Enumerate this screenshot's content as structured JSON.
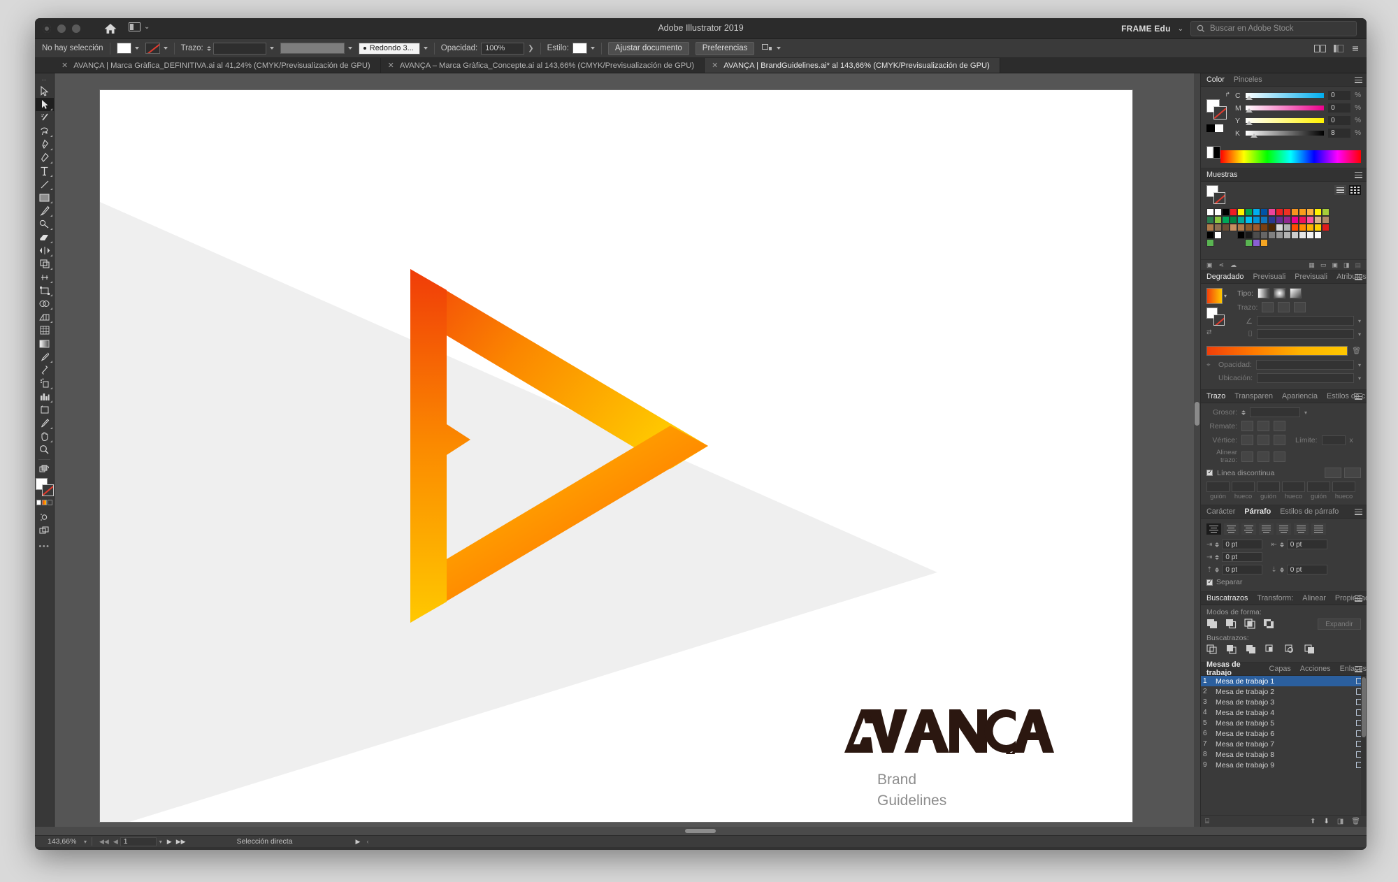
{
  "app": {
    "title": "Adobe Illustrator 2019",
    "workspace": "FRAME Edu",
    "stock_placeholder": "Buscar en Adobe Stock"
  },
  "controlbar": {
    "selection_status": "No hay selección",
    "stroke_label": "Trazo:",
    "brush_value": "Redondo 3...",
    "opacity_label": "Opacidad:",
    "opacity_value": "100%",
    "style_label": "Estilo:",
    "fit_document_button": "Ajustar documento",
    "preferences_button": "Preferencias"
  },
  "document_tabs": [
    {
      "label": "AVANÇA | Marca Gràfica_DEFINITIVA.ai al 41,24% (CMYK/Previsualización de GPU)",
      "active": false
    },
    {
      "label": "AVANÇA – Marca Gràfica_Concepte.ai al 143,66% (CMYK/Previsualización de GPU)",
      "active": false
    },
    {
      "label": "AVANÇA | BrandGuidelines.ai* al 143,66% (CMYK/Previsualización de GPU)",
      "active": true
    }
  ],
  "toolbar": {
    "tools": [
      "selection-tool",
      "direct-selection-tool",
      "magic-wand-tool",
      "lasso-tool",
      "pen-tool",
      "curvature-tool",
      "type-tool",
      "line-segment-tool",
      "rectangle-tool",
      "paintbrush-tool",
      "shaper-tool",
      "eraser-tool",
      "rotate-tool",
      "scale-tool",
      "width-tool",
      "free-transform-tool",
      "shape-builder-tool",
      "perspective-grid-tool",
      "mesh-tool",
      "gradient-tool",
      "eyedropper-tool",
      "blend-tool",
      "symbol-sprayer-tool",
      "column-graph-tool",
      "artboard-tool",
      "slice-tool",
      "hand-tool",
      "zoom-tool"
    ],
    "selected_tool": "direct-selection-tool"
  },
  "canvas": {
    "brand_name": "AVANÇA",
    "brand_subtitle_line1": "Brand",
    "brand_subtitle_line2": "Guidelines",
    "gradient_start": "#F2400A",
    "gradient_end": "#FFC800",
    "wedge_color": "#EFEFEF",
    "wordmark_color": "#2B1710",
    "subtitle_color": "#8D8D8D"
  },
  "panels": {
    "color": {
      "tabs": [
        "Color",
        "Pinceles"
      ],
      "active_tab": "Color",
      "channels": [
        {
          "label": "C",
          "value": "0",
          "unit": "%"
        },
        {
          "label": "M",
          "value": "0",
          "unit": "%"
        },
        {
          "label": "Y",
          "value": "0",
          "unit": "%"
        },
        {
          "label": "K",
          "value": "8",
          "unit": "%"
        }
      ]
    },
    "swatches": {
      "tabs": [
        "Muestras"
      ],
      "active_tab": "Muestras",
      "rows": [
        [
          "#ffffff",
          "#000000",
          "#ed1c24",
          "#fff200",
          "#00a650",
          "#00aeef",
          "#0054a6",
          "#ec449c",
          "#ed2024",
          "#ee3124",
          "#f7941e",
          "#f99d1c",
          "#fbb040",
          "#fff200",
          "#a6ce39",
          "#8dc63f"
        ],
        [
          "#00a859",
          "#008542",
          "#00a99d",
          "#00bff3",
          "#0095da",
          "#0f75bc",
          "#2b3990",
          "#662d91",
          "#92278f",
          "#ec008c",
          "#ed145b",
          "#f852a0",
          "#d9b38c",
          "#b08968",
          "#8c6f52",
          "#6b4f35"
        ],
        [
          "#c89060",
          "#b07b4a",
          "#8a5a2b",
          "#a05a2c",
          "#7b3f10",
          "#4d2600",
          "#d9d9d9",
          "#b3b3b3",
          "#ff4d00",
          "#ff8c00",
          "#ffb400",
          "#ffd000",
          "#e01b1b",
          "#ffffff"
        ],
        [
          "#000000",
          "#1a1a1a",
          "#4d4d4d",
          "#666666",
          "#808080",
          "#999999",
          "#b3b3b3",
          "#cccccc",
          "#e6e6e6",
          "#f2f2f2",
          "#fafafa"
        ],
        [
          "#5ab552",
          "#8a5fd4",
          "#f5a623"
        ]
      ]
    },
    "gradient": {
      "tabs": [
        "Degradado",
        "Previsuali",
        "Previsuali",
        "Atributos"
      ],
      "active_tab": "Degradado",
      "type_label": "Tipo:",
      "stroke_label": "Trazo:",
      "opacity_label": "Opacidad:",
      "location_label": "Ubicación:"
    },
    "stroke": {
      "tabs": [
        "Trazo",
        "Transparen",
        "Apariencia",
        "Estilos de c"
      ],
      "active_tab": "Trazo",
      "weight_label": "Grosor:",
      "cap_label": "Remate:",
      "corner_label": "Vértice:",
      "limit_label": "Límite:",
      "limit_unit": "x",
      "align_label": "Alinear trazo:",
      "dashed_label": "Línea discontinua",
      "dash_fields": [
        "guión",
        "hueco",
        "guión",
        "hueco",
        "guión",
        "hueco"
      ]
    },
    "paragraph": {
      "tabs": [
        "Carácter",
        "Párrafo",
        "Estilos de párrafo"
      ],
      "active_tab": "Párrafo",
      "values": [
        "0 pt",
        "0 pt",
        "0 pt",
        "0 pt",
        "0 pt"
      ],
      "hyphenate_label": "Separar"
    },
    "pathfinder": {
      "tabs": [
        "Buscatrazos",
        "Transform:",
        "Alinear",
        "Propiedade"
      ],
      "active_tab": "Buscatrazos",
      "shape_modes_label": "Modos de forma:",
      "expand_button": "Expandir",
      "pathfinders_label": "Buscatrazos:"
    },
    "artboards": {
      "tabs": [
        "Mesas de trabajo",
        "Capas",
        "Acciones",
        "Enlaces"
      ],
      "active_tab": "Mesas de trabajo",
      "items": [
        {
          "index": "1",
          "name": "Mesa de trabajo 1",
          "selected": true
        },
        {
          "index": "2",
          "name": "Mesa de trabajo 2",
          "selected": false
        },
        {
          "index": "3",
          "name": "Mesa de trabajo 3",
          "selected": false
        },
        {
          "index": "4",
          "name": "Mesa de trabajo 4",
          "selected": false
        },
        {
          "index": "5",
          "name": "Mesa de trabajo 5",
          "selected": false
        },
        {
          "index": "6",
          "name": "Mesa de trabajo 6",
          "selected": false
        },
        {
          "index": "7",
          "name": "Mesa de trabajo 7",
          "selected": false
        },
        {
          "index": "8",
          "name": "Mesa de trabajo 8",
          "selected": false
        },
        {
          "index": "9",
          "name": "Mesa de trabajo 9",
          "selected": false
        }
      ]
    }
  },
  "statusbar": {
    "zoom": "143,66%",
    "artboard_number": "1",
    "status_text": "Selección directa"
  }
}
